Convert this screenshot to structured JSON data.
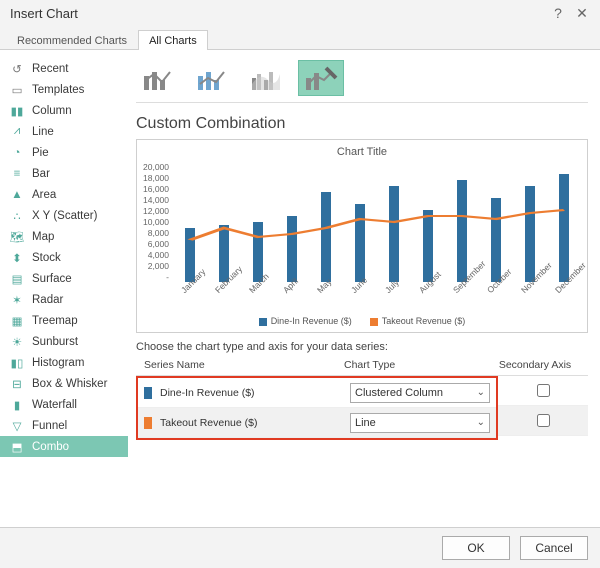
{
  "title": "Insert Chart",
  "tabs": {
    "recommended": "Recommended Charts",
    "all": "All Charts"
  },
  "sidebar": [
    {
      "label": "Recent",
      "icon": "undo-icon"
    },
    {
      "label": "Templates",
      "icon": "folder-icon"
    },
    {
      "label": "Column",
      "icon": "column-icon"
    },
    {
      "label": "Line",
      "icon": "line-icon"
    },
    {
      "label": "Pie",
      "icon": "pie-icon"
    },
    {
      "label": "Bar",
      "icon": "bar-icon"
    },
    {
      "label": "Area",
      "icon": "area-icon"
    },
    {
      "label": "X Y (Scatter)",
      "icon": "scatter-icon"
    },
    {
      "label": "Map",
      "icon": "map-icon"
    },
    {
      "label": "Stock",
      "icon": "stock-icon"
    },
    {
      "label": "Surface",
      "icon": "surface-icon"
    },
    {
      "label": "Radar",
      "icon": "radar-icon"
    },
    {
      "label": "Treemap",
      "icon": "treemap-icon"
    },
    {
      "label": "Sunburst",
      "icon": "sunburst-icon"
    },
    {
      "label": "Histogram",
      "icon": "histogram-icon"
    },
    {
      "label": "Box & Whisker",
      "icon": "box-icon"
    },
    {
      "label": "Waterfall",
      "icon": "waterfall-icon"
    },
    {
      "label": "Funnel",
      "icon": "funnel-icon"
    },
    {
      "label": "Combo",
      "icon": "combo-icon"
    }
  ],
  "selected_sidebar": 18,
  "section_heading": "Custom Combination",
  "chart_title": "Chart Title",
  "yticks": [
    "20,000",
    "18,000",
    "16,000",
    "14,000",
    "12,000",
    "10,000",
    "8,000",
    "6,000",
    "4,000",
    "2,000",
    "-"
  ],
  "series_config_label": "Choose the chart type and axis for your data series:",
  "series_headers": {
    "name": "Series Name",
    "type": "Chart Type",
    "axis": "Secondary Axis"
  },
  "series": [
    {
      "swatch": "#2f6f9e",
      "name": "Dine-In Revenue ($)",
      "type": "Clustered Column",
      "secondary": false
    },
    {
      "swatch": "#ed7d31",
      "name": "Takeout Revenue ($)",
      "type": "Line",
      "secondary": false
    }
  ],
  "legend": [
    {
      "swatch": "#2f6f9e",
      "label": "Dine-In Revenue ($)"
    },
    {
      "swatch": "#ed7d31",
      "label": "Takeout Revenue ($)"
    }
  ],
  "buttons": {
    "ok": "OK",
    "cancel": "Cancel"
  },
  "chart_data": {
    "type": "combo",
    "title": "Chart Title",
    "categories": [
      "January",
      "February",
      "March",
      "April",
      "May",
      "June",
      "July",
      "August",
      "September",
      "October",
      "November",
      "December"
    ],
    "ylabel": "",
    "ylim": [
      0,
      20000
    ],
    "series": [
      {
        "name": "Dine-In Revenue ($)",
        "type": "bar",
        "values": [
          9000,
          9500,
          10000,
          11000,
          15000,
          13000,
          16000,
          12000,
          17000,
          14000,
          16000,
          18000
        ]
      },
      {
        "name": "Takeout Revenue ($)",
        "type": "line",
        "values": [
          7000,
          9000,
          7500,
          8000,
          9000,
          10500,
          10000,
          11000,
          11000,
          10500,
          11500,
          12000
        ]
      }
    ]
  }
}
